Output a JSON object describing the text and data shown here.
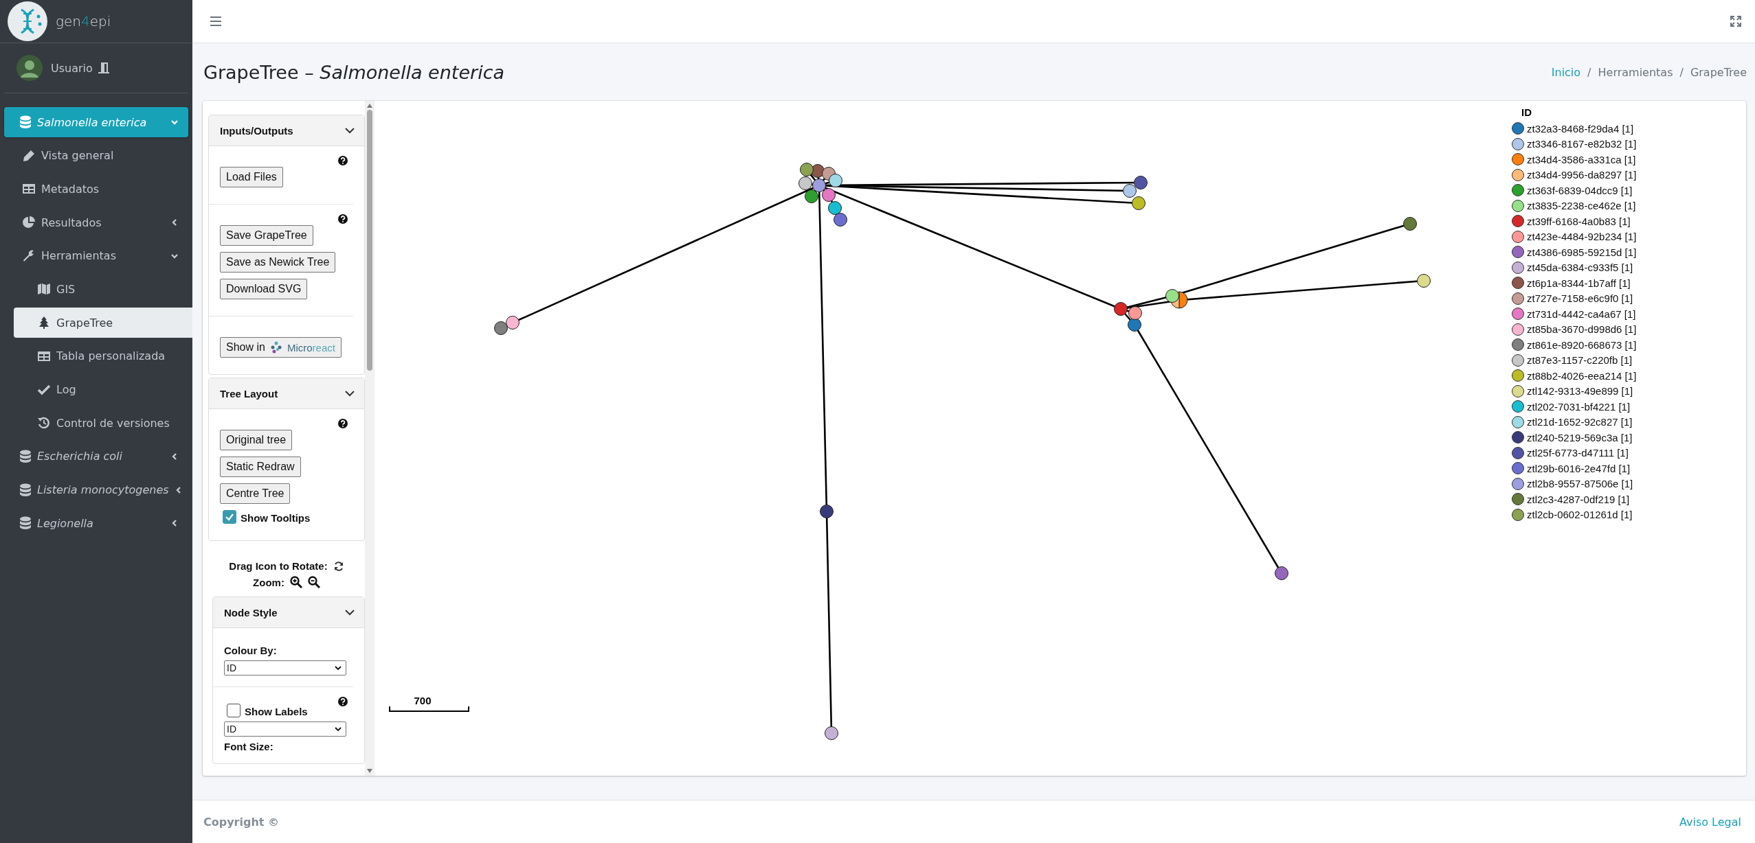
{
  "brand": {
    "prefix": "gen",
    "highlight": "4",
    "suffix": "epi"
  },
  "user": {
    "name": "Usuario"
  },
  "sidebar": {
    "items": [
      {
        "label": "Salmonella enterica",
        "selected": true,
        "expanded": true,
        "children": [
          {
            "label": "Vista general",
            "selected": false
          },
          {
            "label": "Metadatos",
            "selected": false
          },
          {
            "label": "Resultados",
            "selected": false,
            "expanded": false
          },
          {
            "label": "Herramientas",
            "selected": false,
            "expanded": true,
            "children": [
              {
                "label": "GIS",
                "selected": false
              },
              {
                "label": "GrapeTree",
                "selected": true
              },
              {
                "label": "Tabla personalizada",
                "selected": false
              },
              {
                "label": "Log",
                "selected": false
              },
              {
                "label": "Control de versiones",
                "selected": false
              }
            ]
          }
        ]
      },
      {
        "label": "Escherichia coli",
        "selected": false,
        "expanded": false
      },
      {
        "label": "Listeria monocytogenes",
        "selected": false,
        "expanded": false
      },
      {
        "label": "Legionella",
        "selected": false,
        "expanded": false
      }
    ]
  },
  "page": {
    "title": "GrapeTree – *Salmonella enterica*",
    "breadcrumb": {
      "separator": "/",
      "items": [
        {
          "label": "Inicio",
          "kind": "link"
        },
        {
          "label": "Herramientas",
          "kind": "text"
        },
        {
          "label": "GrapeTree",
          "kind": "text"
        }
      ]
    }
  },
  "panel": {
    "inputs_outputs": {
      "title": "Inputs/Outputs",
      "expanded": true,
      "groups": [
        {
          "help": true,
          "buttons": [
            "Load Files"
          ]
        },
        {
          "help": true,
          "buttons": [
            "Save GrapeTree",
            "Save as Newick Tree",
            "Download SVG"
          ]
        },
        {
          "help": false,
          "microreact": {
            "label": "Show in",
            "logo_main": "Micro",
            "logo_accent": "react"
          }
        }
      ]
    },
    "tree_layout": {
      "title": "Tree Layout",
      "expanded": true,
      "help": true,
      "buttons": [
        "Original tree",
        "Static Redraw",
        "Centre Tree"
      ],
      "tooltips": {
        "label": "Show Tooltips",
        "checked": true
      }
    },
    "rotate_label": "Drag Icon to Rotate:",
    "zoom_label": "Zoom:",
    "node_style": {
      "title": "Node Style",
      "expanded": true,
      "colour_by": {
        "label": "Colour By:",
        "value": "ID"
      },
      "help": true,
      "show_labels": {
        "label": "Show Labels",
        "checked": false
      },
      "label_field": {
        "value": "ID"
      },
      "font_size_label": "Font Size:"
    }
  },
  "tree": {
    "scale_label": "700"
  },
  "legend": {
    "title": "ID",
    "items": [
      {
        "label": "zt32a3-8468-f29da4 [1]",
        "color": "#1f77b4"
      },
      {
        "label": "zt3346-8167-e82b32 [1]",
        "color": "#aec7e8"
      },
      {
        "label": "zt34d4-3586-a331ca [1]",
        "color": "#ff7f0e"
      },
      {
        "label": "zt34d4-9956-da8297 [1]",
        "color": "#ffbb78"
      },
      {
        "label": "zt363f-6839-04dcc9 [1]",
        "color": "#2ca02c"
      },
      {
        "label": "zt3835-2238-ce462e [1]",
        "color": "#98df8a"
      },
      {
        "label": "zt39ff-6168-4a0b83 [1]",
        "color": "#d62728"
      },
      {
        "label": "zt423e-4484-92b234 [1]",
        "color": "#ff9896"
      },
      {
        "label": "zt4386-6985-59215d [1]",
        "color": "#9467bd"
      },
      {
        "label": "zt45da-6384-c933f5 [1]",
        "color": "#c5b0d5"
      },
      {
        "label": "zt6p1a-8344-1b7aff [1]",
        "color": "#8c564b"
      },
      {
        "label": "zt727e-7158-e6c9f0 [1]",
        "color": "#c49c94"
      },
      {
        "label": "zt731d-4442-ca4a67 [1]",
        "color": "#e377c2"
      },
      {
        "label": "zt85ba-3670-d998d6 [1]",
        "color": "#f7b6d2"
      },
      {
        "label": "zt861e-8920-668673 [1]",
        "color": "#7f7f7f"
      },
      {
        "label": "zt87e3-1157-c220fb [1]",
        "color": "#c7c7c7"
      },
      {
        "label": "zt88b2-4026-eea214 [1]",
        "color": "#bcbd22"
      },
      {
        "label": "ztl142-9313-49e899 [1]",
        "color": "#dbdb8d"
      },
      {
        "label": "ztl202-7031-bf4221 [1]",
        "color": "#17becf"
      },
      {
        "label": "ztl21d-1652-92c827 [1]",
        "color": "#9edae5"
      },
      {
        "label": "ztl240-5219-569c3a [1]",
        "color": "#393b79"
      },
      {
        "label": "ztl25f-6773-d47111 [1]",
        "color": "#5254a3"
      },
      {
        "label": "ztl29b-6016-2e47fd [1]",
        "color": "#6b6ecf"
      },
      {
        "label": "ztl2b8-9557-87506e [1]",
        "color": "#9c9ede"
      },
      {
        "label": "ztl2c3-4287-0df219 [1]",
        "color": "#637939"
      },
      {
        "label": "ztl2cb-0602-01261d [1]",
        "color": "#8ca252"
      }
    ]
  },
  "footer": {
    "copyright": "Copyright ©",
    "link": "Aviso Legal"
  }
}
